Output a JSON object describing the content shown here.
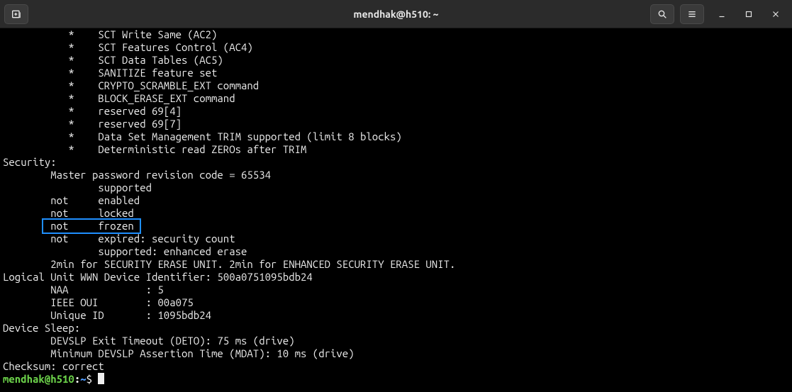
{
  "window": {
    "title": "mendhak@h510: ~"
  },
  "icons": {
    "new_tab": "new-tab-icon",
    "search": "search-icon",
    "menu": "hamburger-menu-icon",
    "min": "minimize-icon",
    "max": "maximize-icon",
    "close": "close-icon"
  },
  "highlight": {
    "text": "not     frozen"
  },
  "terminal": {
    "lines": [
      "           *    SCT Write Same (AC2)",
      "           *    SCT Features Control (AC4)",
      "           *    SCT Data Tables (AC5)",
      "           *    SANITIZE feature set",
      "           *    CRYPTO_SCRAMBLE_EXT command",
      "           *    BLOCK_ERASE_EXT command",
      "           *    reserved 69[4]",
      "           *    reserved 69[7]",
      "           *    Data Set Management TRIM supported (limit 8 blocks)",
      "           *    Deterministic read ZEROs after TRIM",
      "Security: ",
      "        Master password revision code = 65534",
      "                supported",
      "        not     enabled",
      "        not     locked",
      "        not     frozen",
      "        not     expired: security count",
      "                supported: enhanced erase",
      "        2min for SECURITY ERASE UNIT. 2min for ENHANCED SECURITY ERASE UNIT.",
      "Logical Unit WWN Device Identifier: 500a0751095bdb24",
      "        NAA             : 5",
      "        IEEE OUI        : 00a075",
      "        Unique ID       : 1095bdb24",
      "Device Sleep:",
      "        DEVSLP Exit Timeout (DETO): 75 ms (drive)",
      "        Minimum DEVSLP Assertion Time (MDAT): 10 ms (drive)",
      "Checksum: correct"
    ],
    "prompt": {
      "user_host": "mendhak@h510",
      "separator": ":",
      "path": "~",
      "symbol": "$"
    }
  }
}
